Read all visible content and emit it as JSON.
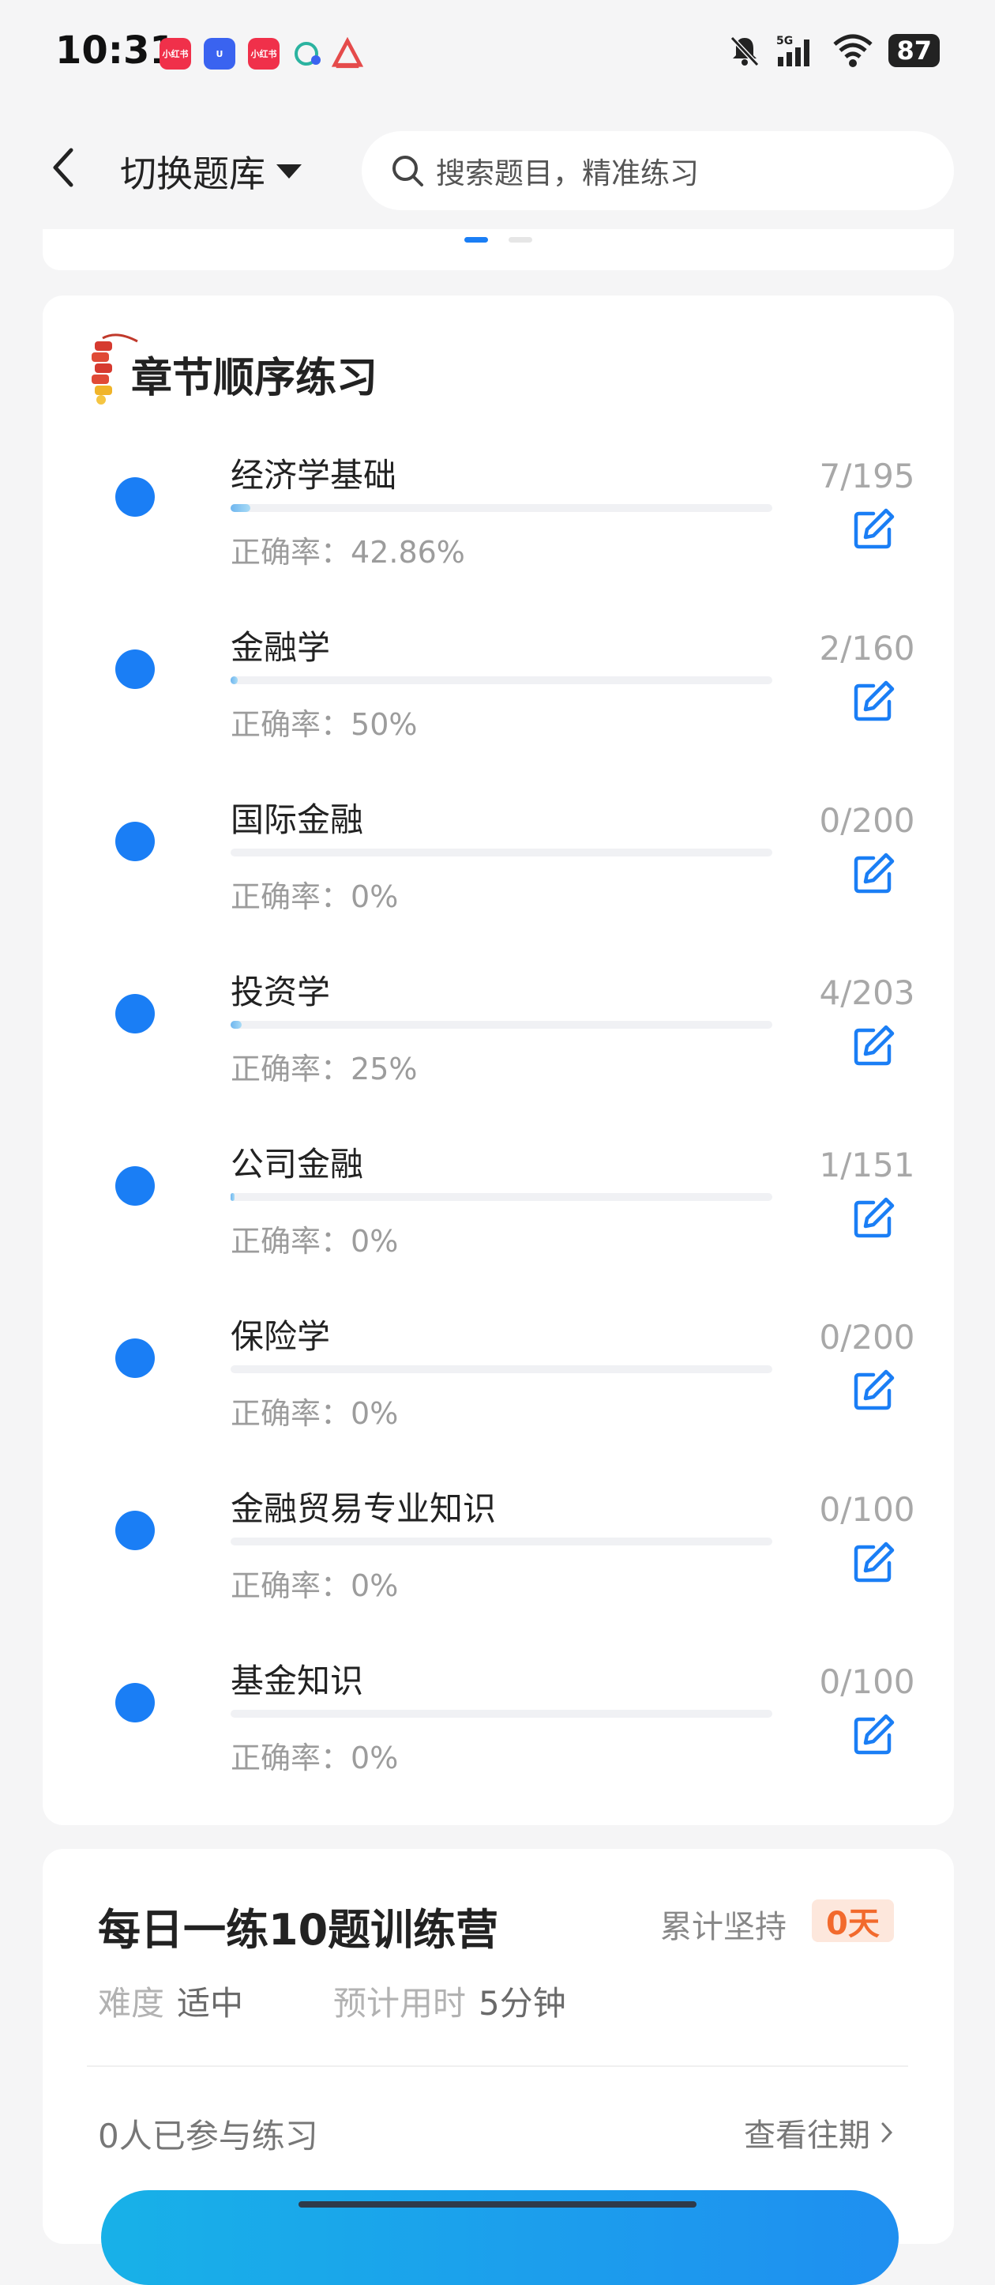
{
  "status": {
    "time": "10:31",
    "battery": "87",
    "network": "5G",
    "apps": [
      {
        "name": "xiaohongshu-icon",
        "color": "#f0304a",
        "label": "小红书"
      },
      {
        "name": "app-blue-icon",
        "color": "#3a63f0",
        "label": "U"
      },
      {
        "name": "xiaohongshu-icon-2",
        "color": "#f0304a",
        "label": "小红书"
      },
      {
        "name": "chat-bubble-icon",
        "color": "#ffffff",
        "label": ""
      },
      {
        "name": "triangle-app-icon",
        "color": "#ffffff",
        "label": ""
      }
    ]
  },
  "header": {
    "switch_label": "切换题库",
    "search_placeholder": "搜索题目，精准练习"
  },
  "chapter_section": {
    "title": "章节顺序练习",
    "accuracy_prefix": "正确率：",
    "chapters": [
      {
        "name": "经济学基础",
        "accuracy": "42.86%",
        "count": "7/195",
        "progress": 0.036
      },
      {
        "name": "金融学",
        "accuracy": "50%",
        "count": "2/160",
        "progress": 0.0125
      },
      {
        "name": "国际金融",
        "accuracy": "0%",
        "count": "0/200",
        "progress": 0
      },
      {
        "name": "投资学",
        "accuracy": "25%",
        "count": "4/203",
        "progress": 0.02
      },
      {
        "name": "公司金融",
        "accuracy": "0%",
        "count": "1/151",
        "progress": 0.0066
      },
      {
        "name": "保险学",
        "accuracy": "0%",
        "count": "0/200",
        "progress": 0
      },
      {
        "name": "金融贸易专业知识",
        "accuracy": "0%",
        "count": "0/100",
        "progress": 0
      },
      {
        "name": "基金知识",
        "accuracy": "0%",
        "count": "0/100",
        "progress": 0
      }
    ]
  },
  "daily": {
    "title": "每日一练10题训练营",
    "streak_label": "累计坚持",
    "streak_value": "0天",
    "difficulty_label": "难度",
    "difficulty_value": "适中",
    "time_label": "预计用时",
    "time_value": "5分钟",
    "participants": "0人已参与练习",
    "history_link": "查看往期"
  },
  "colors": {
    "accent": "#1a7ef5",
    "streak": "#f26a2d"
  }
}
